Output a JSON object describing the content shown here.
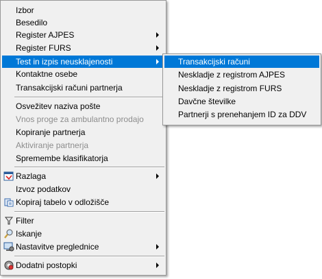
{
  "main_menu": {
    "items": [
      {
        "label": "Izbor"
      },
      {
        "label": "Besedilo"
      },
      {
        "label": "Register AJPES"
      },
      {
        "label": "Register FURS"
      },
      {
        "label": "Test in izpis neusklajenosti"
      },
      {
        "label": "Kontaktne osebe"
      },
      {
        "label": "Transakcijski računi partnerja"
      },
      {
        "label": "Osvežitev naziva pošte"
      },
      {
        "label": "Vnos proge za ambulantno prodajo"
      },
      {
        "label": "Kopiranje partnerja"
      },
      {
        "label": "Aktiviranje partnerja"
      },
      {
        "label": "Spremembe klasifikatorja"
      },
      {
        "label": "Razlaga"
      },
      {
        "label": "Izvoz podatkov"
      },
      {
        "label": "Kopiraj tabelo v odložišče"
      },
      {
        "label": "Filter"
      },
      {
        "label": "Iskanje"
      },
      {
        "label": "Nastavitve preglednice"
      },
      {
        "label": "Dodatni postopki"
      }
    ]
  },
  "sub_menu": {
    "items": [
      {
        "label": "Transakcijski računi"
      },
      {
        "label": "Neskladje z registrom AJPES"
      },
      {
        "label": "Neskladje z registrom FURS"
      },
      {
        "label": "Davčne številke"
      },
      {
        "label": "Partnerji s prenehanjem ID za DDV"
      }
    ]
  },
  "colors": {
    "highlight": "#0078d7",
    "menu_bg": "#f0f0f0",
    "disabled": "#8d8d8d"
  },
  "icons": [
    "razlaga-icon",
    "kopiraj-icon",
    "filter-icon",
    "iskanje-icon",
    "nastavitve-icon",
    "dodatni-postopki-icon"
  ]
}
